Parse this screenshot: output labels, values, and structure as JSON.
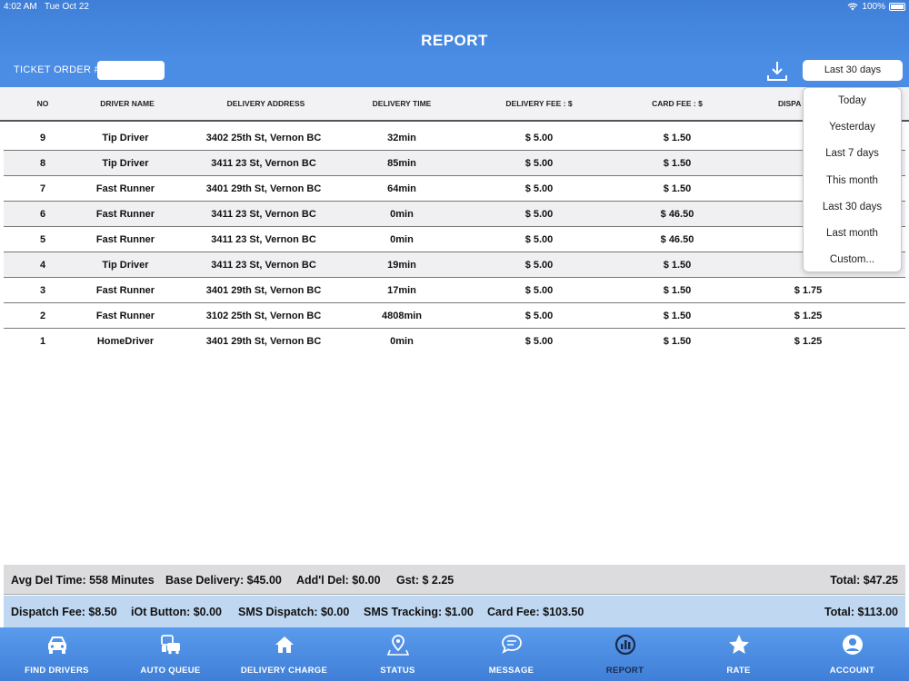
{
  "statusbar": {
    "time": "4:02 AM",
    "date": "Tue Oct 22",
    "battery": "100%"
  },
  "header": {
    "title": "REPORT"
  },
  "toolbar": {
    "ticket_label": "TICKET ORDER #",
    "ticket_value": "",
    "range_label": "Last 30 days"
  },
  "table": {
    "columns": [
      "NO",
      "DRIVER NAME",
      "DELIVERY ADDRESS",
      "DELIVERY TIME",
      "DELIVERY FEE : $",
      "CARD FEE : $",
      "DISPA"
    ],
    "rows": [
      {
        "no": "9",
        "driver": "Tip Driver",
        "address": "3402 25th St, Vernon BC",
        "time": "32min",
        "delivery_fee": "$ 5.00",
        "card_fee": "$ 1.50",
        "dispatch": ""
      },
      {
        "no": "8",
        "driver": "Tip Driver",
        "address": "3411 23 St, Vernon BC",
        "time": "85min",
        "delivery_fee": "$ 5.00",
        "card_fee": "$ 1.50",
        "dispatch": ""
      },
      {
        "no": "7",
        "driver": "Fast Runner",
        "address": "3401 29th St, Vernon BC",
        "time": "64min",
        "delivery_fee": "$ 5.00",
        "card_fee": "$ 1.50",
        "dispatch": ""
      },
      {
        "no": "6",
        "driver": "Fast Runner",
        "address": "3411 23 St, Vernon BC",
        "time": "0min",
        "delivery_fee": "$ 5.00",
        "card_fee": "$ 46.50",
        "dispatch": ""
      },
      {
        "no": "5",
        "driver": "Fast Runner",
        "address": "3411 23 St, Vernon BC",
        "time": "0min",
        "delivery_fee": "$ 5.00",
        "card_fee": "$ 46.50",
        "dispatch": ""
      },
      {
        "no": "4",
        "driver": "Tip Driver",
        "address": "3411 23 St, Vernon BC",
        "time": "19min",
        "delivery_fee": "$ 5.00",
        "card_fee": "$ 1.50",
        "dispatch": ""
      },
      {
        "no": "3",
        "driver": "Fast Runner",
        "address": "3401 29th St, Vernon BC",
        "time": "17min",
        "delivery_fee": "$ 5.00",
        "card_fee": "$ 1.50",
        "dispatch": "$ 1.75"
      },
      {
        "no": "2",
        "driver": "Fast Runner",
        "address": "3102 25th St, Vernon BC",
        "time": "4808min",
        "delivery_fee": "$ 5.00",
        "card_fee": "$ 1.50",
        "dispatch": "$ 1.25"
      },
      {
        "no": "1",
        "driver": "HomeDriver",
        "address": "3401 29th St, Vernon BC",
        "time": "0min",
        "delivery_fee": "$ 5.00",
        "card_fee": "$ 1.50",
        "dispatch": "$ 1.25"
      }
    ]
  },
  "summary1": {
    "avg_del_time": "Avg Del Time: 558 Minutes",
    "base_delivery": "Base Delivery: $45.00",
    "addl_del": "Add'l Del: $0.00",
    "gst": "Gst: $ 2.25",
    "total": "Total: $47.25"
  },
  "summary2": {
    "dispatch_fee": "Dispatch Fee: $8.50",
    "iot_button": "iOt Button: $0.00",
    "sms_dispatch": "SMS Dispatch: $0.00",
    "sms_tracking": "SMS Tracking: $1.00",
    "card_fee": "Card Fee: $103.50",
    "total": "Total: $113.00"
  },
  "dropdown": [
    "Today",
    "Yesterday",
    "Last 7 days",
    "This month",
    "Last 30 days",
    "Last month",
    "Custom..."
  ],
  "nav": [
    {
      "label": "FIND DRIVERS",
      "icon": "car-icon"
    },
    {
      "label": "AUTO QUEUE",
      "icon": "queue-icon"
    },
    {
      "label": "DELIVERY CHARGE",
      "icon": "home-icon"
    },
    {
      "label": "STATUS",
      "icon": "map-pin-icon"
    },
    {
      "label": "MESSAGE",
      "icon": "chat-icon"
    },
    {
      "label": "REPORT",
      "icon": "report-icon"
    },
    {
      "label": "RATE",
      "icon": "star-icon"
    },
    {
      "label": "ACCOUNT",
      "icon": "account-icon"
    }
  ],
  "colors": {
    "header": "#4b8ce5",
    "active_nav": "#1b2a4a"
  }
}
